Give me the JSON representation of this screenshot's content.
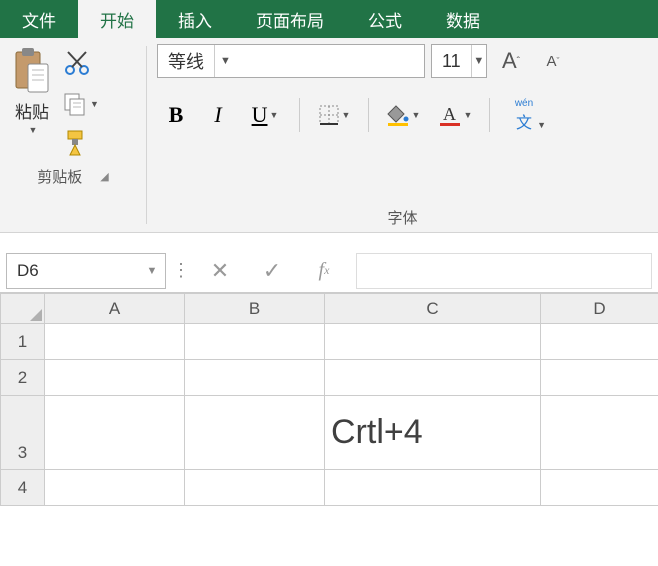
{
  "menu": {
    "file": "文件",
    "home": "开始",
    "insert": "插入",
    "layout": "页面布局",
    "formula": "公式",
    "data": "数据"
  },
  "clipboard": {
    "paste": "粘贴",
    "group_label": "剪贴板"
  },
  "font": {
    "family": "等线",
    "size": "11",
    "group_label": "字体",
    "bold": "B",
    "italic": "I",
    "underline": "U",
    "wen": "wén",
    "wen_char": "文"
  },
  "editbar": {
    "namebox": "D6"
  },
  "grid": {
    "cols": {
      "A": "A",
      "B": "B",
      "C": "C",
      "D": "D"
    },
    "rows": {
      "1": "1",
      "2": "2",
      "3": "3",
      "4": "4"
    },
    "c3": "Crtl+4"
  }
}
